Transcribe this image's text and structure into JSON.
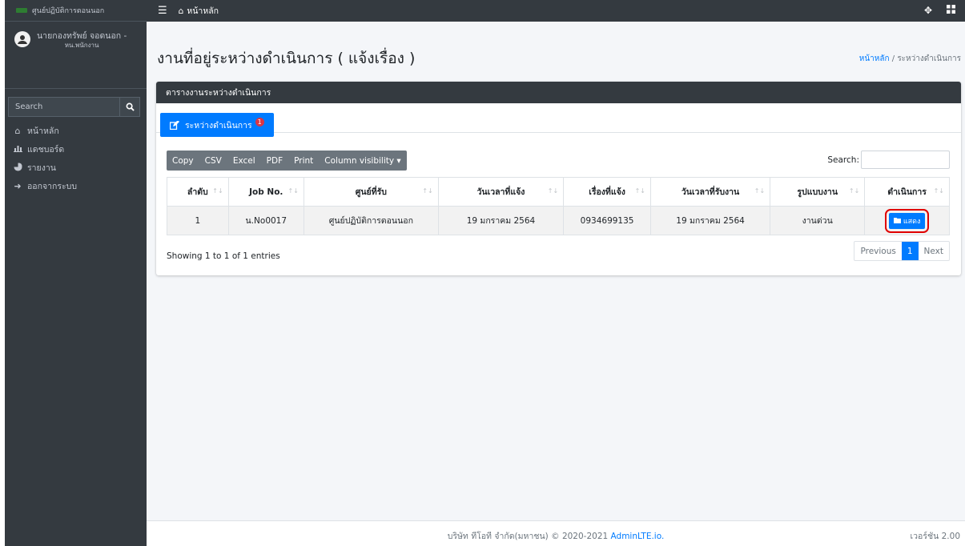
{
  "brand": {
    "title": "ศูนย์ปฏิบัติการตอนนอก"
  },
  "user": {
    "name": "นายกองทรัพย์ จอดนอก -",
    "role": "หน.พนักงาน"
  },
  "sidebar": {
    "search_placeholder": "Search",
    "items": [
      {
        "label": "หน้าหลัก",
        "icon": "home-icon"
      },
      {
        "label": "แดชบอร์ด",
        "icon": "chart-icon"
      },
      {
        "label": "รายงาน",
        "icon": "pie-chart-icon"
      },
      {
        "label": "ออกจากระบบ",
        "icon": "sign-out-icon"
      }
    ]
  },
  "topbar": {
    "home_label": "หน้าหลัก"
  },
  "page": {
    "title": "งานที่อยู่ระหว่างดำเนินการ ( แจ้งเรื่อง )",
    "breadcrumb_home": "หน้าหลัก",
    "breadcrumb_sep": "/",
    "breadcrumb_current": "ระหว่างดำเนินการ"
  },
  "card": {
    "header": "ตารางงานระหว่างดำเนินการ",
    "tab_label": "ระหว่างดำเนินการ",
    "tab_badge": "1"
  },
  "table_tools": {
    "buttons": [
      "Copy",
      "CSV",
      "Excel",
      "PDF",
      "Print",
      "Column visibility ▾"
    ],
    "search_label": "Search:"
  },
  "table": {
    "columns": [
      "ลำดับ",
      "Job No.",
      "ศูนย์ที่รับ",
      "วันเวลาที่แจ้ง",
      "เรื่องที่แจ้ง",
      "วันเวลาที่รับงาน",
      "รูปแบบงาน",
      "ดำเนินการ"
    ],
    "rows": [
      {
        "seq": "1",
        "job_no": "น.No0017",
        "center": "ศูนย์ปฏิบัติการตอนนอก",
        "reported": "19 มกราคม 2564",
        "subject": "0934699135",
        "accepted": "19 มกราคม 2564",
        "type": "งานด่วน",
        "action": "แสดง"
      }
    ]
  },
  "pagination": {
    "info": "Showing 1 to 1 of 1 entries",
    "previous": "Previous",
    "current": "1",
    "next": "Next"
  },
  "footer": {
    "copyright": "บริษัท ทีโอที จำกัด(มหาชน) © 2020-2021 ",
    "brand_link": "AdminLTE.io.",
    "version": "เวอร์ชัน 2.00"
  },
  "colors": {
    "sidebar_bg": "#343a40",
    "accent": "#007bff",
    "badge": "#dc3545",
    "highlight_outline": "#e00000"
  }
}
